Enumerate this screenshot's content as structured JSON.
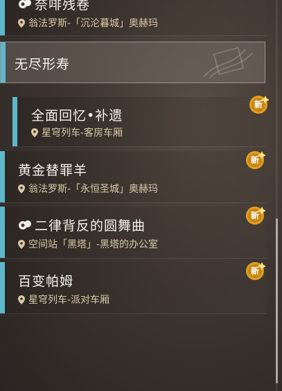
{
  "items": [
    {
      "title": "奈啡残卷",
      "location": "翁法罗斯-「沉沦暮城」奥赫玛",
      "icon": "mission-icon"
    },
    {
      "title": "全面回忆•补遗",
      "location": "星穹列车-客房车厢",
      "badge": "新"
    },
    {
      "title": "黄金替罪羊",
      "location": "翁法罗斯-「永恒圣城」奥赫玛",
      "badge": "新"
    },
    {
      "title": "二律背反的圆舞曲",
      "location": "空间站「黑塔」-黑塔的办公室",
      "badge": "新",
      "icon": "mission-icon"
    },
    {
      "title": "百变帕姆",
      "location": "星穹列车-派对车厢",
      "badge": "新"
    }
  ],
  "header": {
    "title": "无尽形寿"
  },
  "colors": {
    "accent": "#5fb8c9",
    "badge": "#e0a020",
    "location_text": "#d9c9a8"
  }
}
